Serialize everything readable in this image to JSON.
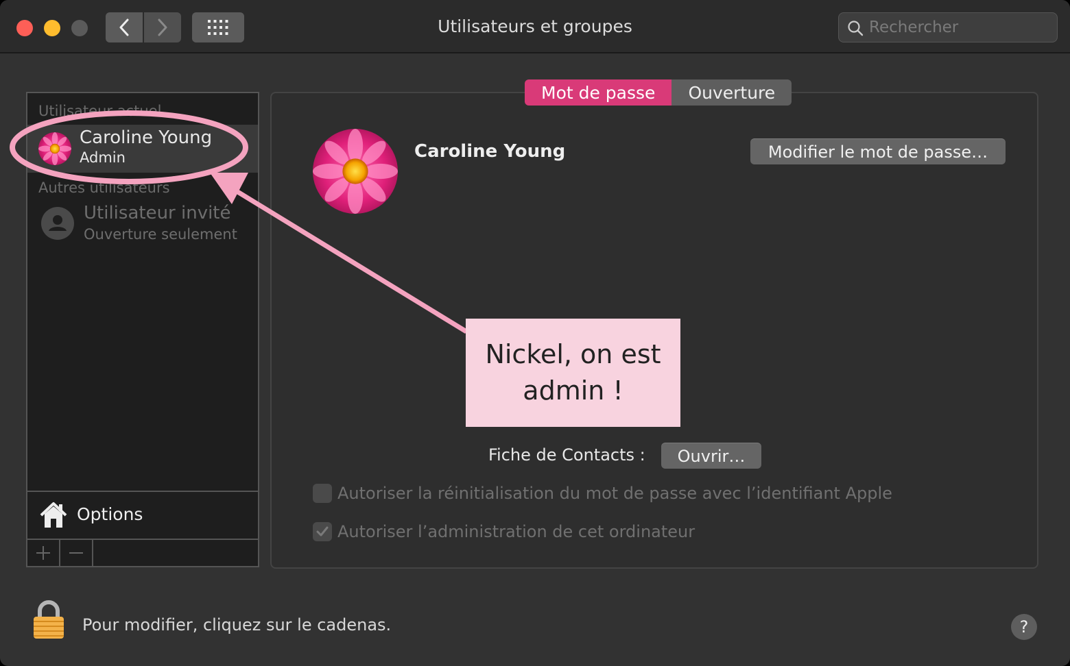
{
  "window": {
    "title": "Utilisateurs et groupes",
    "search_placeholder": "Rechercher"
  },
  "sidebar": {
    "current_users_label": "Utilisateur actuel",
    "current_user": {
      "name": "Caroline Young",
      "role": "Admin"
    },
    "other_users_label": "Autres utilisateurs",
    "guest_user": {
      "name": "Utilisateur invité",
      "subtitle": "Ouverture seulement"
    },
    "options_label": "Options",
    "add_symbol": "+",
    "remove_symbol": "−"
  },
  "tabs": [
    {
      "label": "Mot de passe",
      "active": true
    },
    {
      "label": "Ouverture",
      "active": false
    }
  ],
  "main": {
    "user_name": "Caroline Young",
    "change_password_label": "Modifier le mot de passe…",
    "contacts_label": "Fiche de Contacts :",
    "open_contact_label": "Ouvrir…",
    "allow_reset_label": "Autoriser la réinitialisation du mot de passe avec l’identifiant Apple",
    "allow_reset_checked": false,
    "allow_admin_label": "Autoriser l’administration de cet ordinateur",
    "allow_admin_checked": true
  },
  "footer": {
    "lock_text": "Pour modifier, cliquez sur le cadenas.",
    "help_symbol": "?"
  },
  "annotation": {
    "text_line1": "Nickel, on est",
    "text_line2": "admin !",
    "color": "#f4a3bf"
  }
}
